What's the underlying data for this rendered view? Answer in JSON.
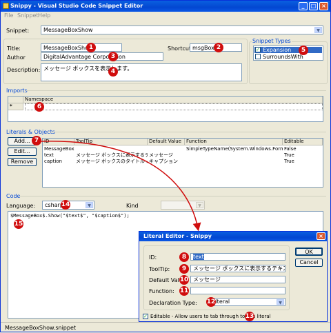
{
  "window": {
    "title": "Snippy - Visual Studio Code Snippet Editor",
    "menu": [
      "File",
      "Snippet",
      "Help"
    ]
  },
  "snippet_select": {
    "label": "Snippet:",
    "value": "MessageBoxShow"
  },
  "header": {
    "title_label": "Title:",
    "title_value": "MessageBoxShow",
    "shortcut_label": "Shortcut:",
    "shortcut_value": "msgBox",
    "author_label": "Author",
    "author_value": "DigitalAdvantage Corporation",
    "description_label": "Description:",
    "description_value": "メッセージ ボックスを表示します。"
  },
  "snippet_types": {
    "title": "Snippet Types",
    "items": [
      {
        "label": "Expansion",
        "checked": true,
        "selected": true
      },
      {
        "label": "SurroundsWith",
        "checked": false,
        "selected": false
      }
    ]
  },
  "imports": {
    "title": "Imports",
    "column": "Namespace",
    "new_row_marker": "*"
  },
  "literals": {
    "title": "Literals & Objects",
    "buttons": {
      "add": "Add...",
      "edit": "Edit...",
      "remove": "Remove"
    },
    "columns": [
      "ID",
      "ToolTip",
      "Default Value",
      "Function",
      "Editable"
    ],
    "rows": [
      [
        "MessageBox",
        "",
        "",
        "SimpleTypeName(System.Windows.Form...",
        "False"
      ],
      [
        "text",
        "メッセージ ボックスに表示するテキスト。",
        "メッセージ",
        "",
        "True"
      ],
      [
        "caption",
        "メッセージ ボックスのタイトル バーに...",
        "キャプション",
        "",
        "True"
      ]
    ]
  },
  "code": {
    "title": "Code",
    "language_label": "Language:",
    "language_value": "csharp",
    "kind_label": "Kind",
    "body": "$MessageBox$.Show(\"$text$\", \"$caption$\");"
  },
  "status": {
    "file": "MessageBoxShow.snippet"
  },
  "dialog": {
    "title": "Literal Editor - Snippy",
    "id_label": "ID:",
    "id_value": "text",
    "tooltip_label": "ToolTip:",
    "tooltip_value": "メッセージ ボックスに表示するテキスト。",
    "default_label": "Default Value:",
    "default_value": "メッセージ",
    "function_label": "Function:",
    "function_value": "",
    "decl_label": "Declaration Type:",
    "decl_value": "Literal",
    "editable_label": "Editable - Allow users to tab through to this literal",
    "ok": "OK",
    "cancel": "Cancel"
  },
  "badges": [
    "1",
    "2",
    "3",
    "4",
    "5",
    "6",
    "7",
    "8",
    "9",
    "10",
    "11",
    "12",
    "13",
    "14",
    "15"
  ],
  "colors": {
    "accent": "#0831d9",
    "badge": "#d00d0d",
    "selection": "#316ac5"
  }
}
